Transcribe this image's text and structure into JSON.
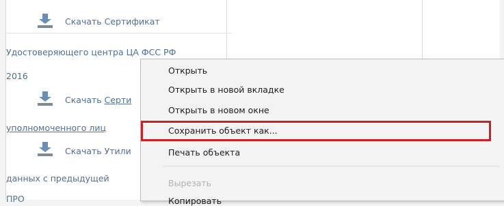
{
  "page": {
    "link1": "Скачать Сертификат",
    "line2": "Удостоверяющего центра ЦА ФСС РФ",
    "line3": "2016",
    "link2_prefix": "Скачать",
    "link2_partial": "Серти",
    "line5": "уполномоченного лиц",
    "link3": "Скачать Утили",
    "line7": "данных с предыдущей",
    "line8": "ПРО"
  },
  "context_menu": {
    "items": [
      {
        "label": "Открыть",
        "enabled": true
      },
      {
        "label": "Открыть в новой вкладке",
        "enabled": true
      },
      {
        "label": "Открыть в новом окне",
        "enabled": true
      },
      {
        "label": "Сохранить объект как...",
        "enabled": true,
        "highlighted": true
      },
      {
        "label": "Печать объекта",
        "enabled": true
      },
      {
        "label": "Вырезать",
        "enabled": false
      },
      {
        "label": "Копировать",
        "enabled": true
      }
    ],
    "highlight_color": "#cc1f24"
  },
  "icons": [
    "download-icon"
  ]
}
